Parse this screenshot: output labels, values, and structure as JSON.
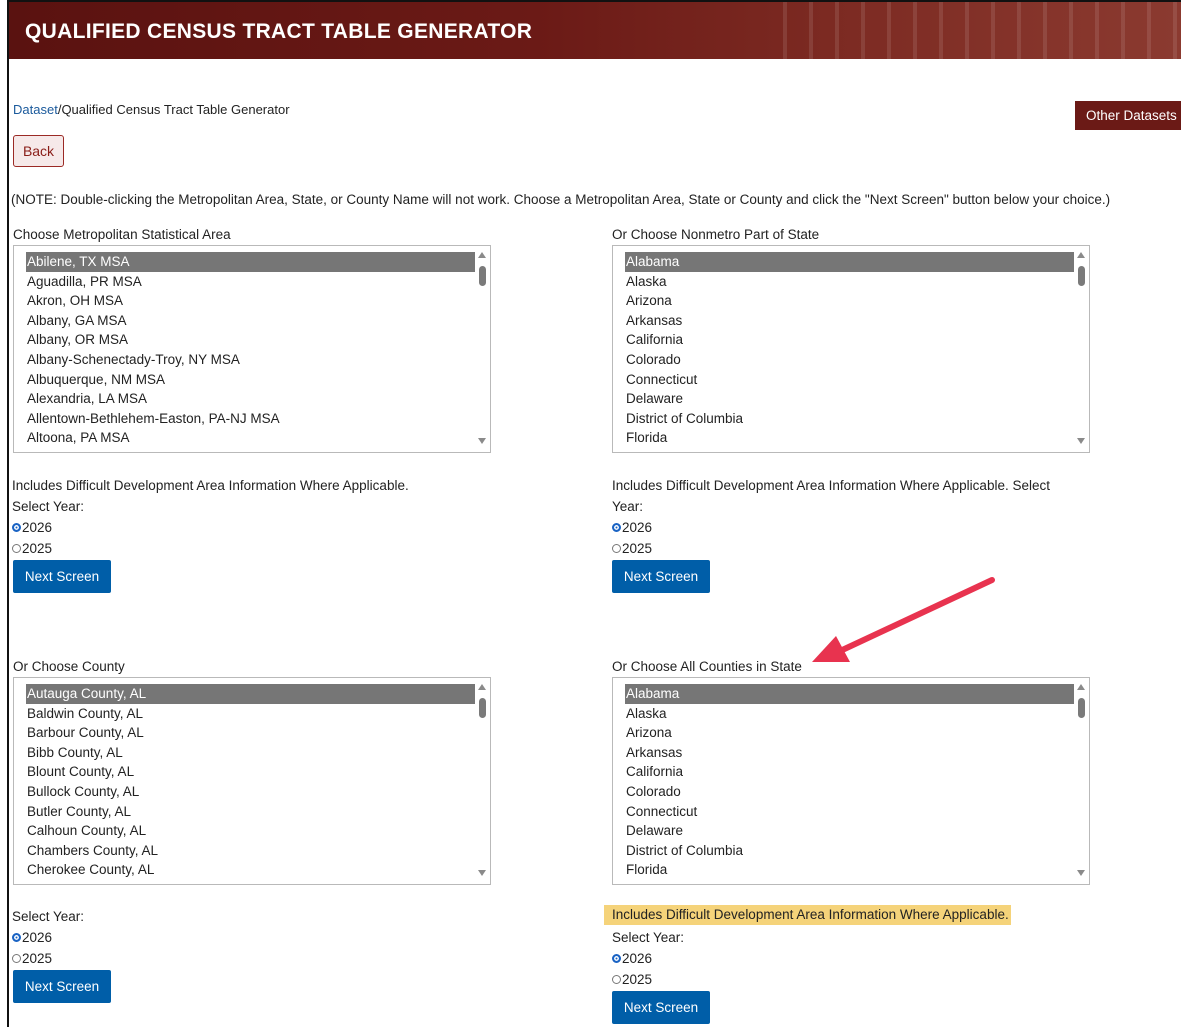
{
  "header": {
    "title": "QUALIFIED CENSUS TRACT TABLE GENERATOR"
  },
  "breadcrumb": {
    "link": "Dataset",
    "separator": "/",
    "current": "Qualified Census Tract Table Generator"
  },
  "buttons": {
    "other_datasets": "Other Datasets",
    "back": "Back",
    "next": "Next Screen"
  },
  "note": "(NOTE: Double-clicking the Metropolitan Area, State, or County Name will not work.  Choose a Metropolitan Area, State or County and click the \"Next Screen\" button below your choice.)",
  "msa": {
    "label": "Choose Metropolitan Statistical Area",
    "items": [
      "Abilene, TX MSA",
      "Aguadilla, PR MSA",
      "Akron, OH MSA",
      "Albany, GA MSA",
      "Albany, OR MSA",
      "Albany-Schenectady-Troy, NY MSA",
      "Albuquerque, NM MSA",
      "Alexandria, LA MSA",
      "Allentown-Bethlehem-Easton, PA-NJ MSA",
      "Altoona, PA MSA"
    ],
    "selected_index": 0,
    "info": "Includes Difficult Development Area Information Where Applicable.",
    "year_label": "Select Year:",
    "years": [
      "2026",
      "2025"
    ],
    "selected_year": "2026"
  },
  "nonmetro": {
    "label": "Or Choose Nonmetro Part of State",
    "items": [
      "Alabama",
      "Alaska",
      "Arizona",
      "Arkansas",
      "California",
      "Colorado",
      "Connecticut",
      "Delaware",
      "District of Columbia",
      "Florida"
    ],
    "selected_index": 0,
    "info_line1": "Includes Difficult Development Area Information Where Applicable. Select",
    "info_line2": "Year:",
    "years": [
      "2026",
      "2025"
    ],
    "selected_year": "2026"
  },
  "county": {
    "label": "Or Choose County",
    "items": [
      "Autauga County, AL",
      "Baldwin County, AL",
      "Barbour County, AL",
      "Bibb County, AL",
      "Blount County, AL",
      "Bullock County, AL",
      "Butler County, AL",
      "Calhoun County, AL",
      "Chambers County, AL",
      "Cherokee County, AL"
    ],
    "selected_index": 0,
    "year_label": "Select Year:",
    "years": [
      "2026",
      "2025"
    ],
    "selected_year": "2026"
  },
  "all_counties": {
    "label": "Or Choose All Counties in State",
    "items": [
      "Alabama",
      "Alaska",
      "Arizona",
      "Arkansas",
      "California",
      "Colorado",
      "Connecticut",
      "Delaware",
      "District of Columbia",
      "Florida"
    ],
    "selected_index": 0,
    "info": "Includes Difficult Development Area Information Where Applicable.",
    "year_label": "Select Year:",
    "years": [
      "2026",
      "2025"
    ],
    "selected_year": "2026"
  },
  "colors": {
    "banner": "#6b1a16",
    "button_blue": "#005ea8",
    "link": "#1b5a9c",
    "highlight": "#f5d37a",
    "arrow": "#e8334f"
  },
  "icons": [
    "arrow-annotation-icon",
    "scroll-up-icon",
    "scroll-down-icon",
    "radio-selected-icon",
    "radio-unselected-icon"
  ]
}
